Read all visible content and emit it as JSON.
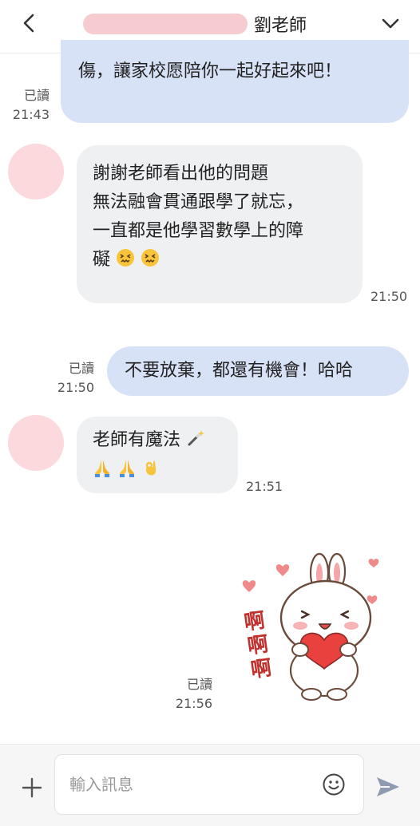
{
  "header": {
    "title": "劉老師"
  },
  "messages": [
    {
      "text": "傷，讓家校愿陪你一起好起來吧！",
      "read": "已讀",
      "time": "21:43"
    },
    {
      "lines": [
        "謝謝老師看出他的問題",
        "無法融會貫通跟學了就忘，",
        "一直都是他學習數學上的障",
        "礙"
      ],
      "emojis": [
        "confounded-face",
        "confounded-face"
      ],
      "time": "21:50"
    },
    {
      "text": "不要放棄，都還有機會！哈哈",
      "read": "已讀",
      "time": "21:50"
    },
    {
      "lines": [
        "老師有魔法"
      ],
      "emojis_line1": [
        "magic-wand"
      ],
      "emojis_line2": [
        "folded-hands",
        "folded-hands",
        "ok-hand"
      ],
      "time": "21:51"
    },
    {
      "sticker_text": "啊啊啊",
      "read": "已讀",
      "time": "21:56"
    }
  ],
  "composer": {
    "placeholder": "輸入訊息"
  },
  "colors": {
    "sent_bubble": "#d7e2f7",
    "received_bubble": "#eff0f2",
    "avatar_blur": "#fcd9dd",
    "name_blur": "#f7c9cf"
  }
}
